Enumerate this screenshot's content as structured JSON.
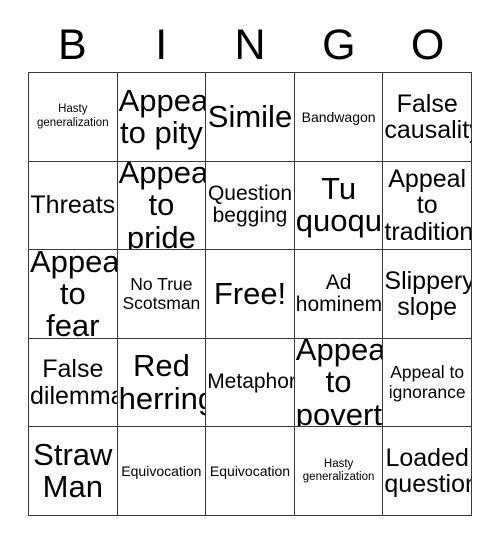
{
  "card": {
    "header_letters": [
      "B",
      "I",
      "N",
      "G",
      "O"
    ],
    "rows": [
      [
        {
          "label": "Hasty generalization",
          "size": "xs"
        },
        {
          "label": "Appeal to pity",
          "size": "xxl"
        },
        {
          "label": "Simile",
          "size": "xxl"
        },
        {
          "label": "Bandwagon",
          "size": "sm"
        },
        {
          "label": "False causality",
          "size": "xl"
        }
      ],
      [
        {
          "label": "Threats",
          "size": "xl"
        },
        {
          "label": "Appeal to pride",
          "size": "xxl"
        },
        {
          "label": "Question begging",
          "size": "lg"
        },
        {
          "label": "Tu quoque",
          "size": "xxl"
        },
        {
          "label": "Appeal to tradition",
          "size": "xl"
        }
      ],
      [
        {
          "label": "Appeal to fear",
          "size": "xxl"
        },
        {
          "label": "No True Scotsman",
          "size": "md"
        },
        {
          "label": "Free!",
          "size": "xxl"
        },
        {
          "label": "Ad hominem",
          "size": "lg"
        },
        {
          "label": "Slippery slope",
          "size": "xl"
        }
      ],
      [
        {
          "label": "False dilemma",
          "size": "xl"
        },
        {
          "label": "Red herring",
          "size": "xxl"
        },
        {
          "label": "Metaphor",
          "size": "lg"
        },
        {
          "label": "Appeal to poverty",
          "size": "xxl"
        },
        {
          "label": "Appeal to ignorance",
          "size": "md"
        }
      ],
      [
        {
          "label": "Straw Man",
          "size": "xxl"
        },
        {
          "label": "Equivocation",
          "size": "sm"
        },
        {
          "label": "Equivocation",
          "size": "sm"
        },
        {
          "label": "Hasty generalization",
          "size": "xs"
        },
        {
          "label": "Loaded question",
          "size": "xl"
        }
      ]
    ],
    "colors": {
      "background": "#ffffff",
      "text": "#000000",
      "border": "#3a3a3a"
    }
  }
}
